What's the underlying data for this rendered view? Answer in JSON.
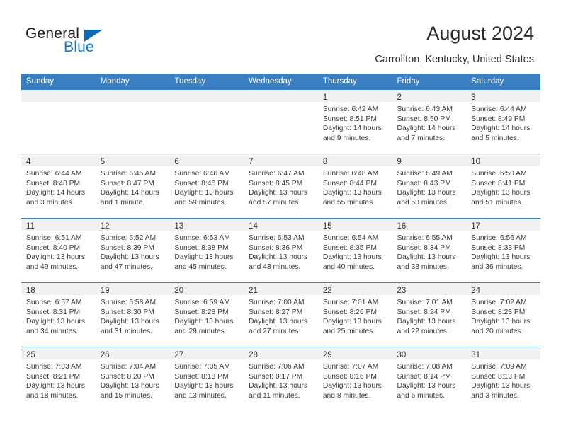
{
  "brand": {
    "name_part1": "General",
    "name_part2": "Blue",
    "flag_color": "#1267ad",
    "blue_color": "#1878be"
  },
  "header": {
    "title": "August 2024",
    "location": "Carrollton, Kentucky, United States"
  },
  "theme": {
    "header_row_bg": "#3a7fc1",
    "daynum_strip_bg": "#f1f1f1",
    "cell_bg": "#ffffff",
    "text_color": "#3a3a3a"
  },
  "weekdays": [
    "Sunday",
    "Monday",
    "Tuesday",
    "Wednesday",
    "Thursday",
    "Friday",
    "Saturday"
  ],
  "weeks": [
    [
      {
        "day": "",
        "lines": []
      },
      {
        "day": "",
        "lines": []
      },
      {
        "day": "",
        "lines": []
      },
      {
        "day": "",
        "lines": []
      },
      {
        "day": "1",
        "lines": [
          "Sunrise: 6:42 AM",
          "Sunset: 8:51 PM",
          "Daylight: 14 hours",
          "and 9 minutes."
        ]
      },
      {
        "day": "2",
        "lines": [
          "Sunrise: 6:43 AM",
          "Sunset: 8:50 PM",
          "Daylight: 14 hours",
          "and 7 minutes."
        ]
      },
      {
        "day": "3",
        "lines": [
          "Sunrise: 6:44 AM",
          "Sunset: 8:49 PM",
          "Daylight: 14 hours",
          "and 5 minutes."
        ]
      }
    ],
    [
      {
        "day": "4",
        "lines": [
          "Sunrise: 6:44 AM",
          "Sunset: 8:48 PM",
          "Daylight: 14 hours",
          "and 3 minutes."
        ]
      },
      {
        "day": "5",
        "lines": [
          "Sunrise: 6:45 AM",
          "Sunset: 8:47 PM",
          "Daylight: 14 hours",
          "and 1 minute."
        ]
      },
      {
        "day": "6",
        "lines": [
          "Sunrise: 6:46 AM",
          "Sunset: 8:46 PM",
          "Daylight: 13 hours",
          "and 59 minutes."
        ]
      },
      {
        "day": "7",
        "lines": [
          "Sunrise: 6:47 AM",
          "Sunset: 8:45 PM",
          "Daylight: 13 hours",
          "and 57 minutes."
        ]
      },
      {
        "day": "8",
        "lines": [
          "Sunrise: 6:48 AM",
          "Sunset: 8:44 PM",
          "Daylight: 13 hours",
          "and 55 minutes."
        ]
      },
      {
        "day": "9",
        "lines": [
          "Sunrise: 6:49 AM",
          "Sunset: 8:43 PM",
          "Daylight: 13 hours",
          "and 53 minutes."
        ]
      },
      {
        "day": "10",
        "lines": [
          "Sunrise: 6:50 AM",
          "Sunset: 8:41 PM",
          "Daylight: 13 hours",
          "and 51 minutes."
        ]
      }
    ],
    [
      {
        "day": "11",
        "lines": [
          "Sunrise: 6:51 AM",
          "Sunset: 8:40 PM",
          "Daylight: 13 hours",
          "and 49 minutes."
        ]
      },
      {
        "day": "12",
        "lines": [
          "Sunrise: 6:52 AM",
          "Sunset: 8:39 PM",
          "Daylight: 13 hours",
          "and 47 minutes."
        ]
      },
      {
        "day": "13",
        "lines": [
          "Sunrise: 6:53 AM",
          "Sunset: 8:38 PM",
          "Daylight: 13 hours",
          "and 45 minutes."
        ]
      },
      {
        "day": "14",
        "lines": [
          "Sunrise: 6:53 AM",
          "Sunset: 8:36 PM",
          "Daylight: 13 hours",
          "and 43 minutes."
        ]
      },
      {
        "day": "15",
        "lines": [
          "Sunrise: 6:54 AM",
          "Sunset: 8:35 PM",
          "Daylight: 13 hours",
          "and 40 minutes."
        ]
      },
      {
        "day": "16",
        "lines": [
          "Sunrise: 6:55 AM",
          "Sunset: 8:34 PM",
          "Daylight: 13 hours",
          "and 38 minutes."
        ]
      },
      {
        "day": "17",
        "lines": [
          "Sunrise: 6:56 AM",
          "Sunset: 8:33 PM",
          "Daylight: 13 hours",
          "and 36 minutes."
        ]
      }
    ],
    [
      {
        "day": "18",
        "lines": [
          "Sunrise: 6:57 AM",
          "Sunset: 8:31 PM",
          "Daylight: 13 hours",
          "and 34 minutes."
        ]
      },
      {
        "day": "19",
        "lines": [
          "Sunrise: 6:58 AM",
          "Sunset: 8:30 PM",
          "Daylight: 13 hours",
          "and 31 minutes."
        ]
      },
      {
        "day": "20",
        "lines": [
          "Sunrise: 6:59 AM",
          "Sunset: 8:28 PM",
          "Daylight: 13 hours",
          "and 29 minutes."
        ]
      },
      {
        "day": "21",
        "lines": [
          "Sunrise: 7:00 AM",
          "Sunset: 8:27 PM",
          "Daylight: 13 hours",
          "and 27 minutes."
        ]
      },
      {
        "day": "22",
        "lines": [
          "Sunrise: 7:01 AM",
          "Sunset: 8:26 PM",
          "Daylight: 13 hours",
          "and 25 minutes."
        ]
      },
      {
        "day": "23",
        "lines": [
          "Sunrise: 7:01 AM",
          "Sunset: 8:24 PM",
          "Daylight: 13 hours",
          "and 22 minutes."
        ]
      },
      {
        "day": "24",
        "lines": [
          "Sunrise: 7:02 AM",
          "Sunset: 8:23 PM",
          "Daylight: 13 hours",
          "and 20 minutes."
        ]
      }
    ],
    [
      {
        "day": "25",
        "lines": [
          "Sunrise: 7:03 AM",
          "Sunset: 8:21 PM",
          "Daylight: 13 hours",
          "and 18 minutes."
        ]
      },
      {
        "day": "26",
        "lines": [
          "Sunrise: 7:04 AM",
          "Sunset: 8:20 PM",
          "Daylight: 13 hours",
          "and 15 minutes."
        ]
      },
      {
        "day": "27",
        "lines": [
          "Sunrise: 7:05 AM",
          "Sunset: 8:18 PM",
          "Daylight: 13 hours",
          "and 13 minutes."
        ]
      },
      {
        "day": "28",
        "lines": [
          "Sunrise: 7:06 AM",
          "Sunset: 8:17 PM",
          "Daylight: 13 hours",
          "and 11 minutes."
        ]
      },
      {
        "day": "29",
        "lines": [
          "Sunrise: 7:07 AM",
          "Sunset: 8:16 PM",
          "Daylight: 13 hours",
          "and 8 minutes."
        ]
      },
      {
        "day": "30",
        "lines": [
          "Sunrise: 7:08 AM",
          "Sunset: 8:14 PM",
          "Daylight: 13 hours",
          "and 6 minutes."
        ]
      },
      {
        "day": "31",
        "lines": [
          "Sunrise: 7:09 AM",
          "Sunset: 8:13 PM",
          "Daylight: 13 hours",
          "and 3 minutes."
        ]
      }
    ]
  ]
}
